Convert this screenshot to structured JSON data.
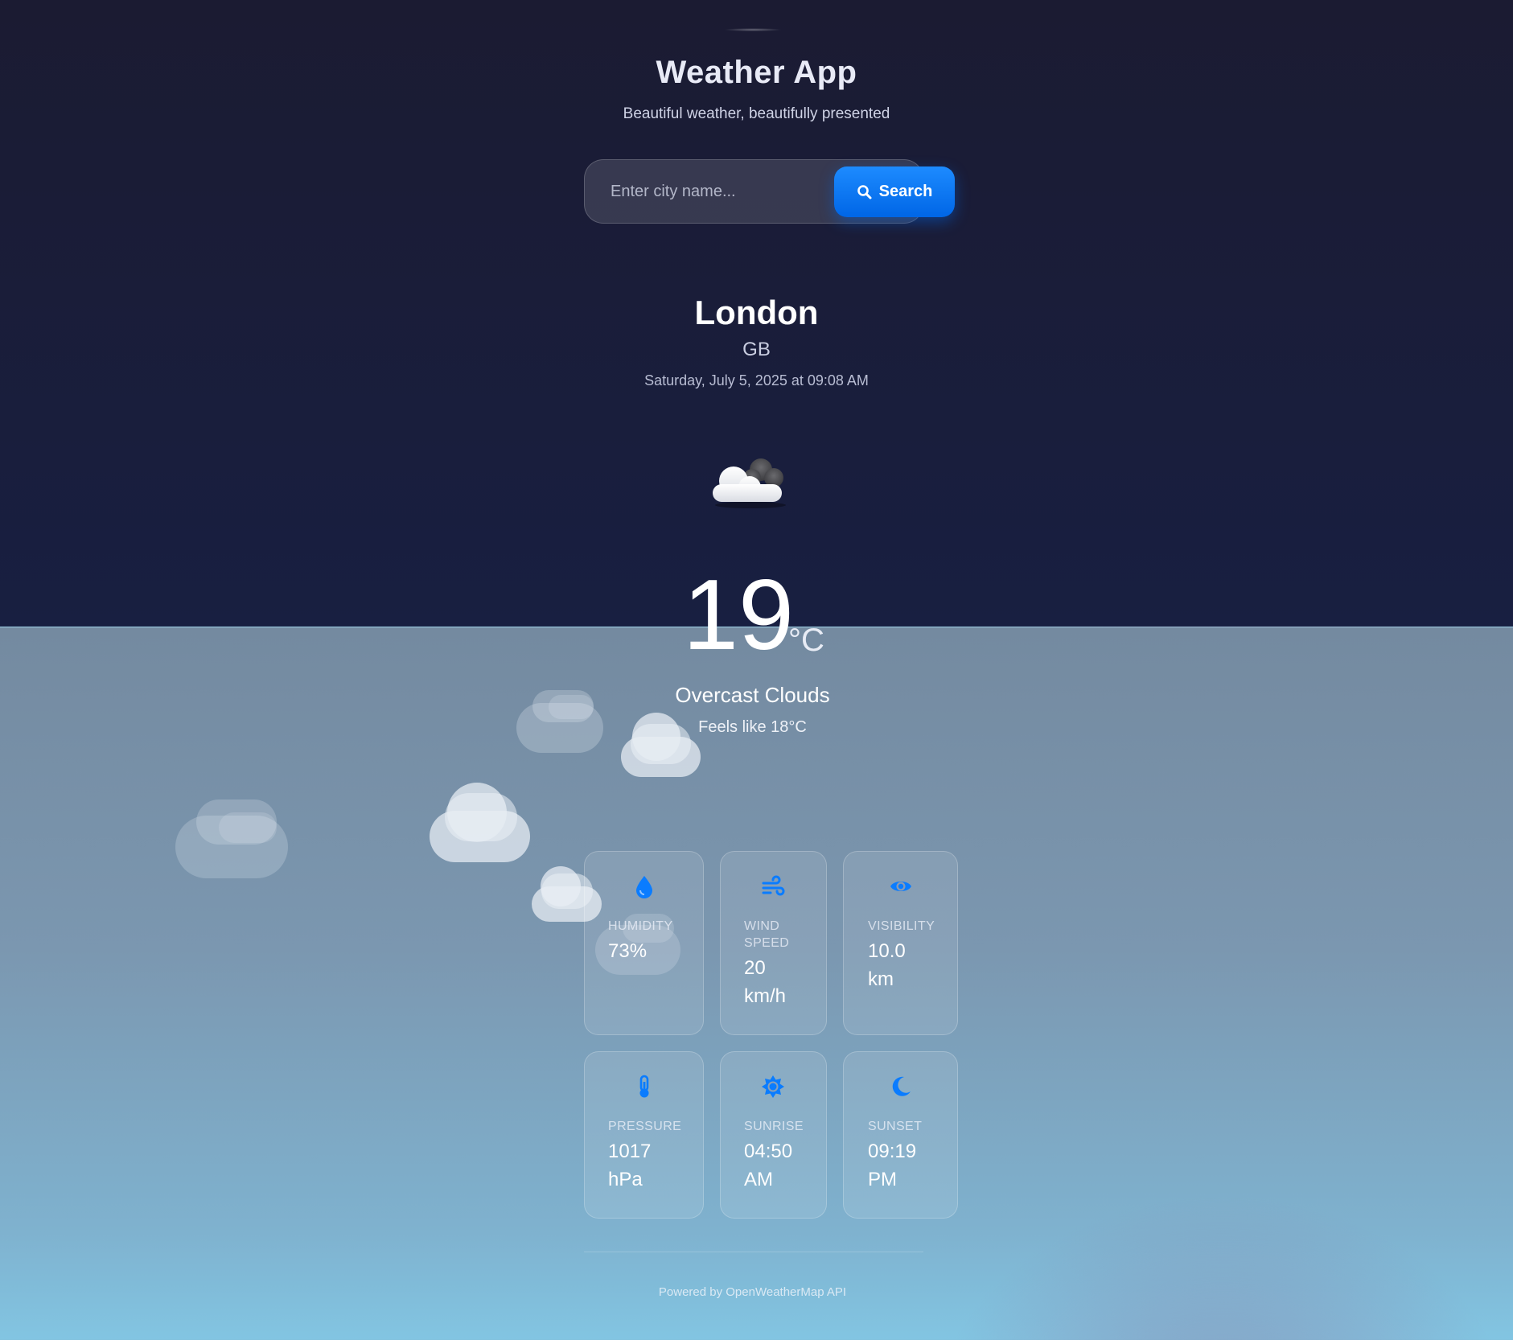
{
  "header": {
    "title": "Weather App",
    "subtitle": "Beautiful weather, beautifully presented"
  },
  "search": {
    "placeholder": "Enter city name...",
    "value": "",
    "button_label": "Search",
    "button_icon": "search-icon"
  },
  "location": {
    "city": "London",
    "country": "GB",
    "datetime": "Saturday, July 5, 2025 at 09:08 AM"
  },
  "current": {
    "icon": "overcast-clouds-icon",
    "temperature": "19",
    "unit": "°C",
    "description": "Overcast Clouds",
    "feels_like": "Feels like 18°C"
  },
  "details": [
    {
      "icon": "droplet-icon",
      "label": "HUMIDITY",
      "value": "73%"
    },
    {
      "icon": "wind-icon",
      "label": "WIND SPEED",
      "value": "20 km/h"
    },
    {
      "icon": "eye-icon",
      "label": "VISIBILITY",
      "value": "10.0 km"
    },
    {
      "icon": "thermometer-icon",
      "label": "PRESSURE",
      "value": "1017 hPa"
    },
    {
      "icon": "sun-icon",
      "label": "SUNRISE",
      "value": "04:50 AM"
    },
    {
      "icon": "moon-icon",
      "label": "SUNSET",
      "value": "09:19 PM"
    }
  ],
  "footer": {
    "text": "Powered by OpenWeatherMap API"
  },
  "colors": {
    "accent": "#0a7cff",
    "background_top": "#1a1c36",
    "background_bottom": "#82c5e2"
  }
}
